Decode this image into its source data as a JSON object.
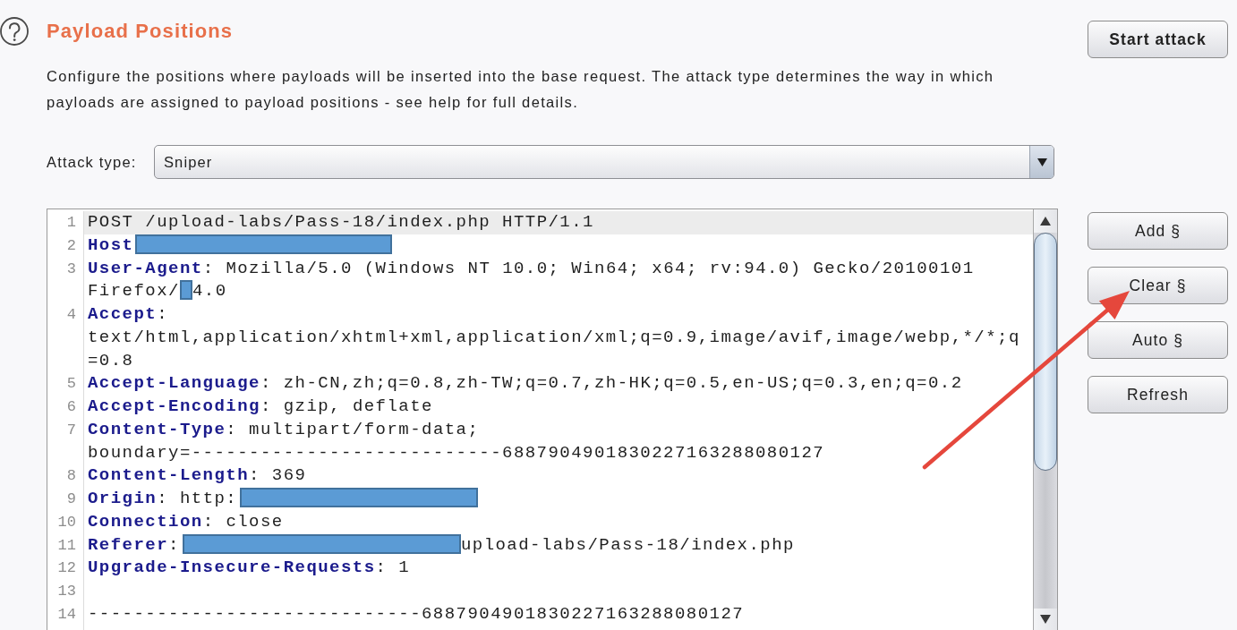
{
  "header": {
    "title": "Payload Positions",
    "description": "Configure the positions where payloads will be inserted into the base request. The attack type determines the way in which payloads are assigned to payload positions - see help for full details."
  },
  "attack_type": {
    "label": "Attack type:",
    "value": "Sniper"
  },
  "editor": {
    "lines": [
      {
        "number": "1",
        "current": true,
        "segments": [
          {
            "kind": "text",
            "text": "POST /upload-labs/Pass-18/index.php HTTP/1.1"
          }
        ]
      },
      {
        "number": "2",
        "current": false,
        "segments": [
          {
            "kind": "header",
            "name": "Host"
          },
          {
            "kind": "redacted"
          }
        ]
      },
      {
        "number": "3",
        "current": false,
        "segments": [
          {
            "kind": "header",
            "name": "User-Agent",
            "text": ": Mozilla/5.0 (Windows NT 10.0; Win64; x64; rv:94.0) Gecko/20100101 "
          },
          {
            "kind": "text",
            "text": "Firefox/"
          },
          {
            "kind": "redacted"
          },
          {
            "kind": "text",
            "text": "4.0"
          }
        ]
      },
      {
        "number": "4",
        "current": false,
        "segments": [
          {
            "kind": "header",
            "name": "Accept",
            "text": ": text/html,application/xhtml+xml,application/xml;q=0.9,image/avif,image/webp,*/*;q=0.8"
          }
        ]
      },
      {
        "number": "5",
        "current": false,
        "segments": [
          {
            "kind": "header",
            "name": "Accept-Language",
            "text": ": zh-CN,zh;q=0.8,zh-TW;q=0.7,zh-HK;q=0.5,en-US;q=0.3,en;q=0.2"
          }
        ]
      },
      {
        "number": "6",
        "current": false,
        "segments": [
          {
            "kind": "header",
            "name": "Accept-Encoding",
            "text": ": gzip, deflate"
          }
        ]
      },
      {
        "number": "7",
        "current": false,
        "segments": [
          {
            "kind": "header",
            "name": "Content-Type",
            "text": ": multipart/form-data; boundary=---------------------------6887904901830227163288080127"
          }
        ]
      },
      {
        "number": "8",
        "current": false,
        "segments": [
          {
            "kind": "header",
            "name": "Content-Length",
            "text": ": 369"
          }
        ]
      },
      {
        "number": "9",
        "current": false,
        "segments": [
          {
            "kind": "header",
            "name": "Origin",
            "text": ": http:"
          },
          {
            "kind": "redacted"
          }
        ]
      },
      {
        "number": "10",
        "current": false,
        "segments": [
          {
            "kind": "header",
            "name": "Connection",
            "text": ": close"
          }
        ]
      },
      {
        "number": "11",
        "current": false,
        "segments": [
          {
            "kind": "header",
            "name": "Referer",
            "text": ":"
          },
          {
            "kind": "redacted"
          },
          {
            "kind": "text",
            "text": "upload-labs/Pass-18/index.php"
          }
        ]
      },
      {
        "number": "12",
        "current": false,
        "segments": [
          {
            "kind": "header",
            "name": "Upgrade-Insecure-Requests",
            "text": ": 1"
          }
        ]
      },
      {
        "number": "13",
        "current": false
      },
      {
        "number": "14",
        "current": false,
        "segments": [
          {
            "kind": "text",
            "text": "-----------------------------6887904901830227163288080127"
          }
        ]
      }
    ]
  },
  "actions": {
    "primary": "Start attack",
    "buttons": [
      "Add §",
      "Clear §",
      "Auto §",
      "Refresh"
    ]
  },
  "annotations": [
    {
      "kind": "arrow"
    }
  ]
}
